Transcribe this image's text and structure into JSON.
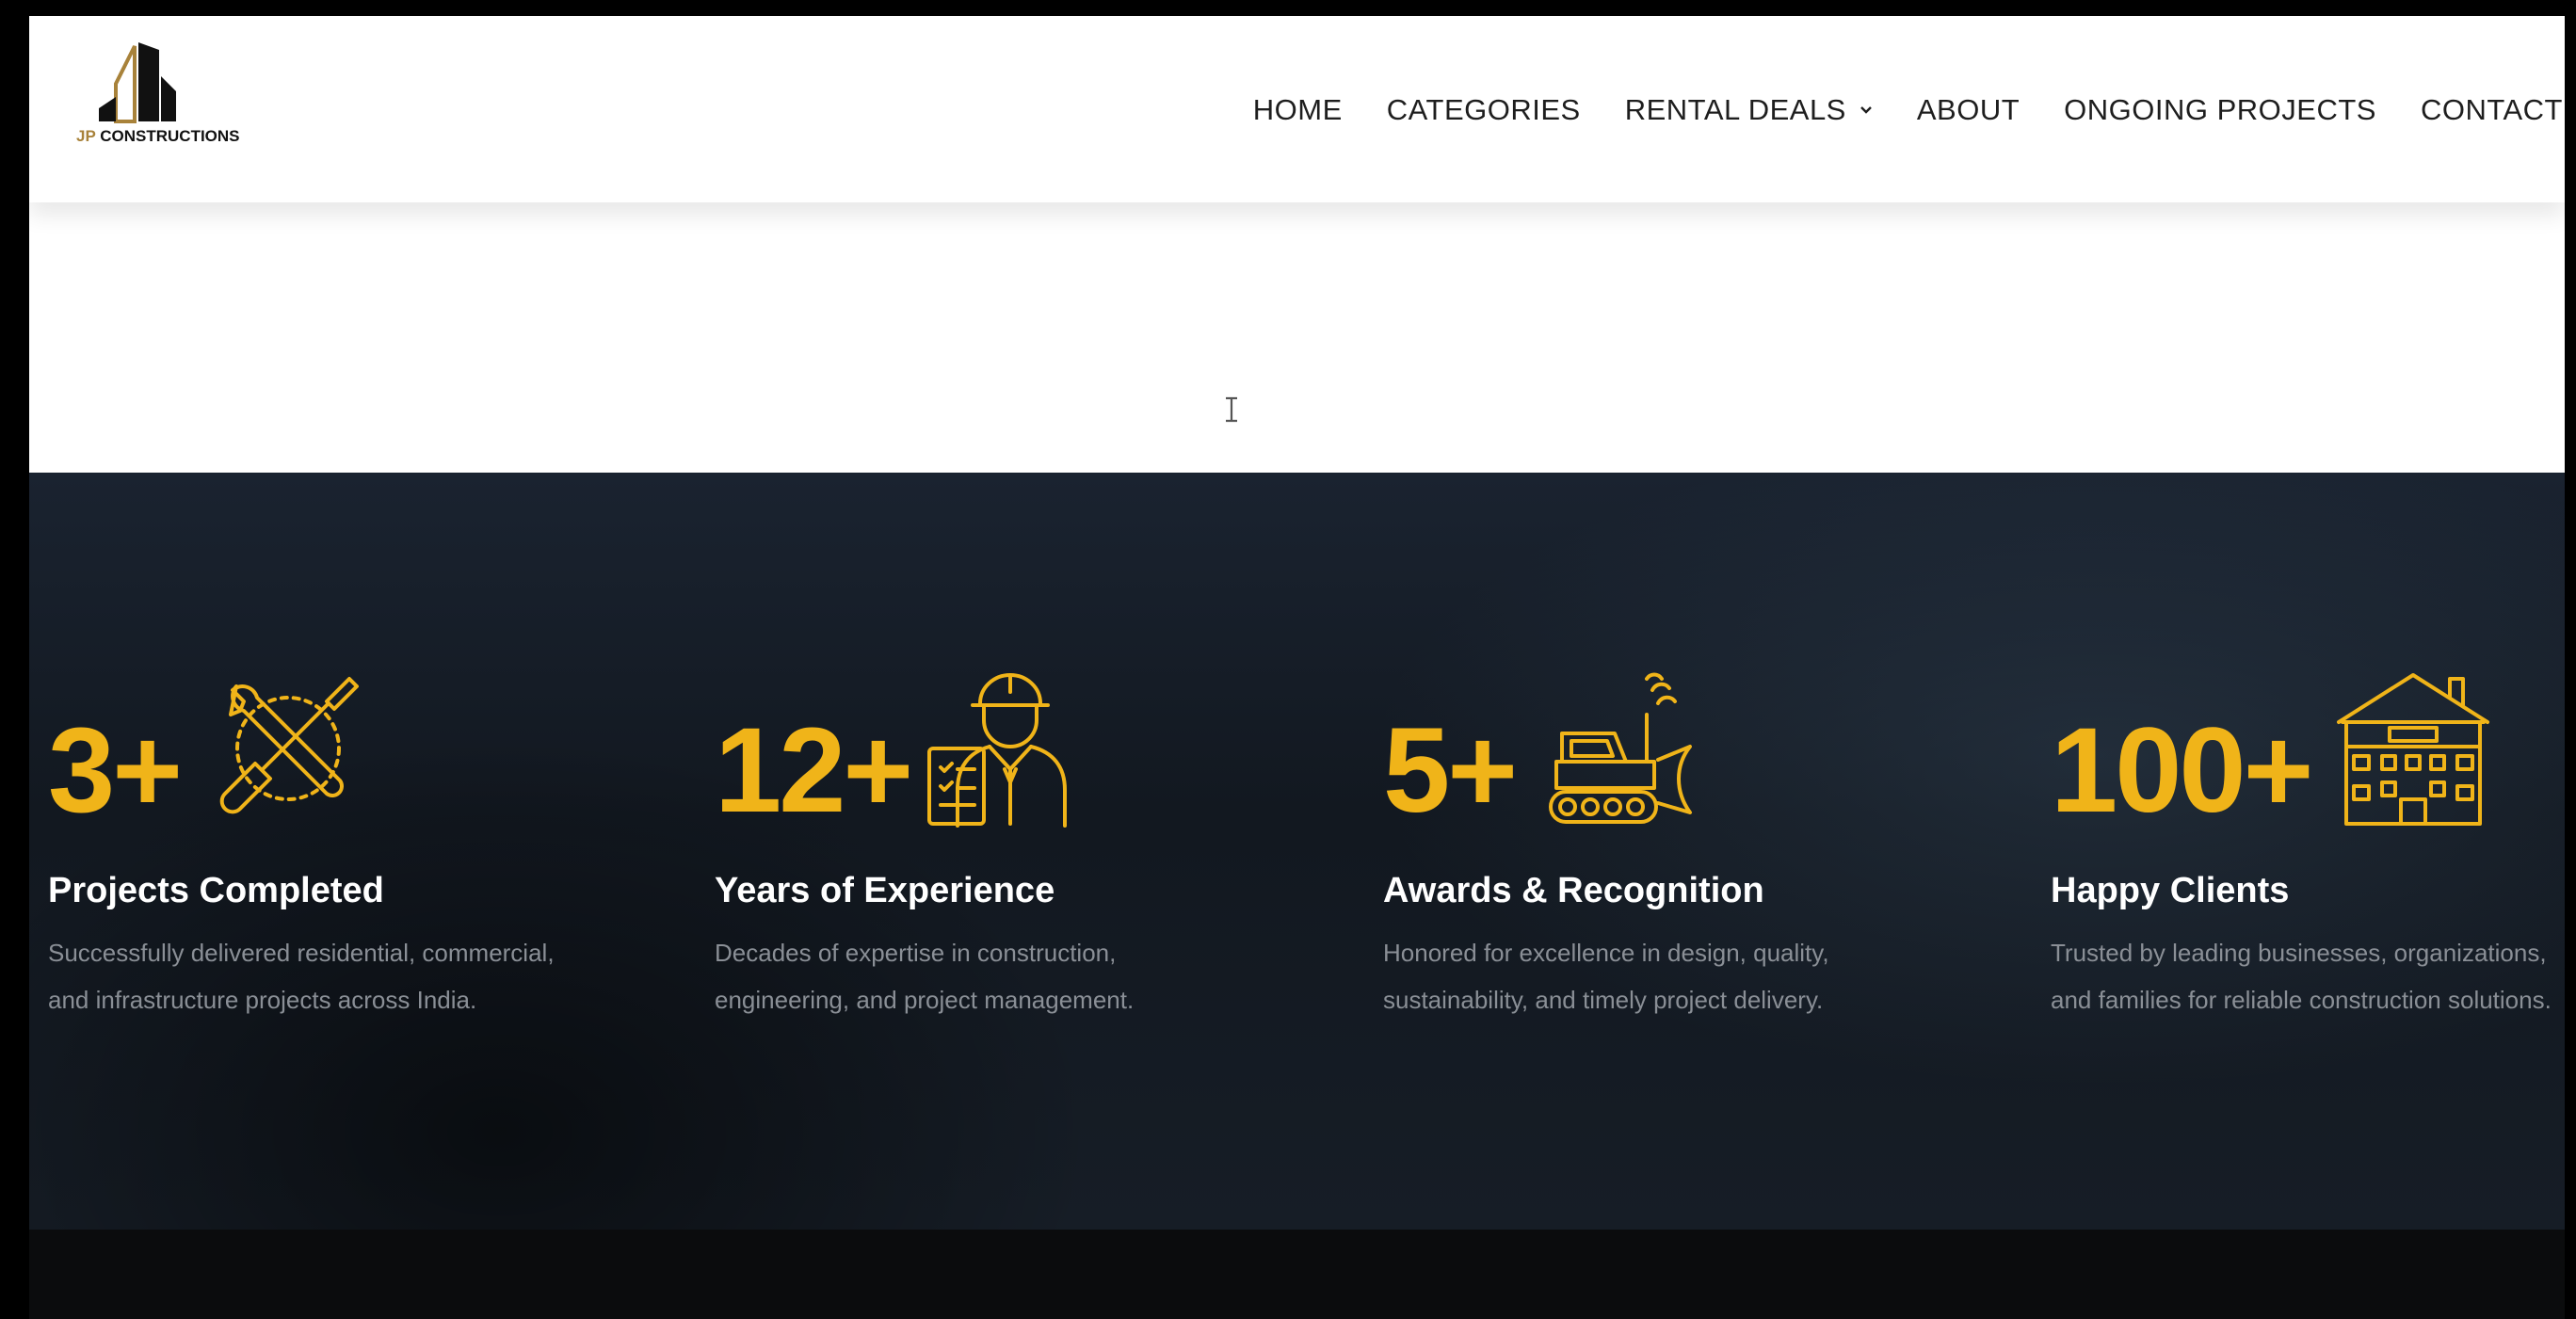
{
  "logo": {
    "prefix": "JP",
    "name": "CONSTRUCTIONS",
    "accent_color": "#a8823a"
  },
  "nav": {
    "items": [
      {
        "label": "HOME"
      },
      {
        "label": "CATEGORIES"
      },
      {
        "label": "RENTAL DEALS",
        "has_dropdown": true
      },
      {
        "label": "ABOUT"
      },
      {
        "label": "ONGOING PROJECTS"
      },
      {
        "label": "CONTACT"
      }
    ]
  },
  "stats": [
    {
      "value": "3+",
      "icon": "wrench-screwdriver-icon",
      "title": "Projects Completed",
      "description": "Successfully delivered residential, commercial, and infrastructure projects across India."
    },
    {
      "value": "12+",
      "icon": "engineer-icon",
      "title": "Years of Experience",
      "description": "Decades of expertise in construction, engineering, and project management."
    },
    {
      "value": "5+",
      "icon": "bulldozer-icon",
      "title": "Awards & Recognition",
      "description": "Honored for excellence in design, quality, sustainability, and timely project delivery."
    },
    {
      "value": "100+",
      "icon": "building-icon",
      "title": "Happy Clients",
      "description": "Trusted by leading businesses, organizations, and families for reliable construction solutions."
    }
  ],
  "colors": {
    "accent": "#f0b419",
    "dark_bg": "#141b24",
    "text_muted": "#8a8f96"
  }
}
